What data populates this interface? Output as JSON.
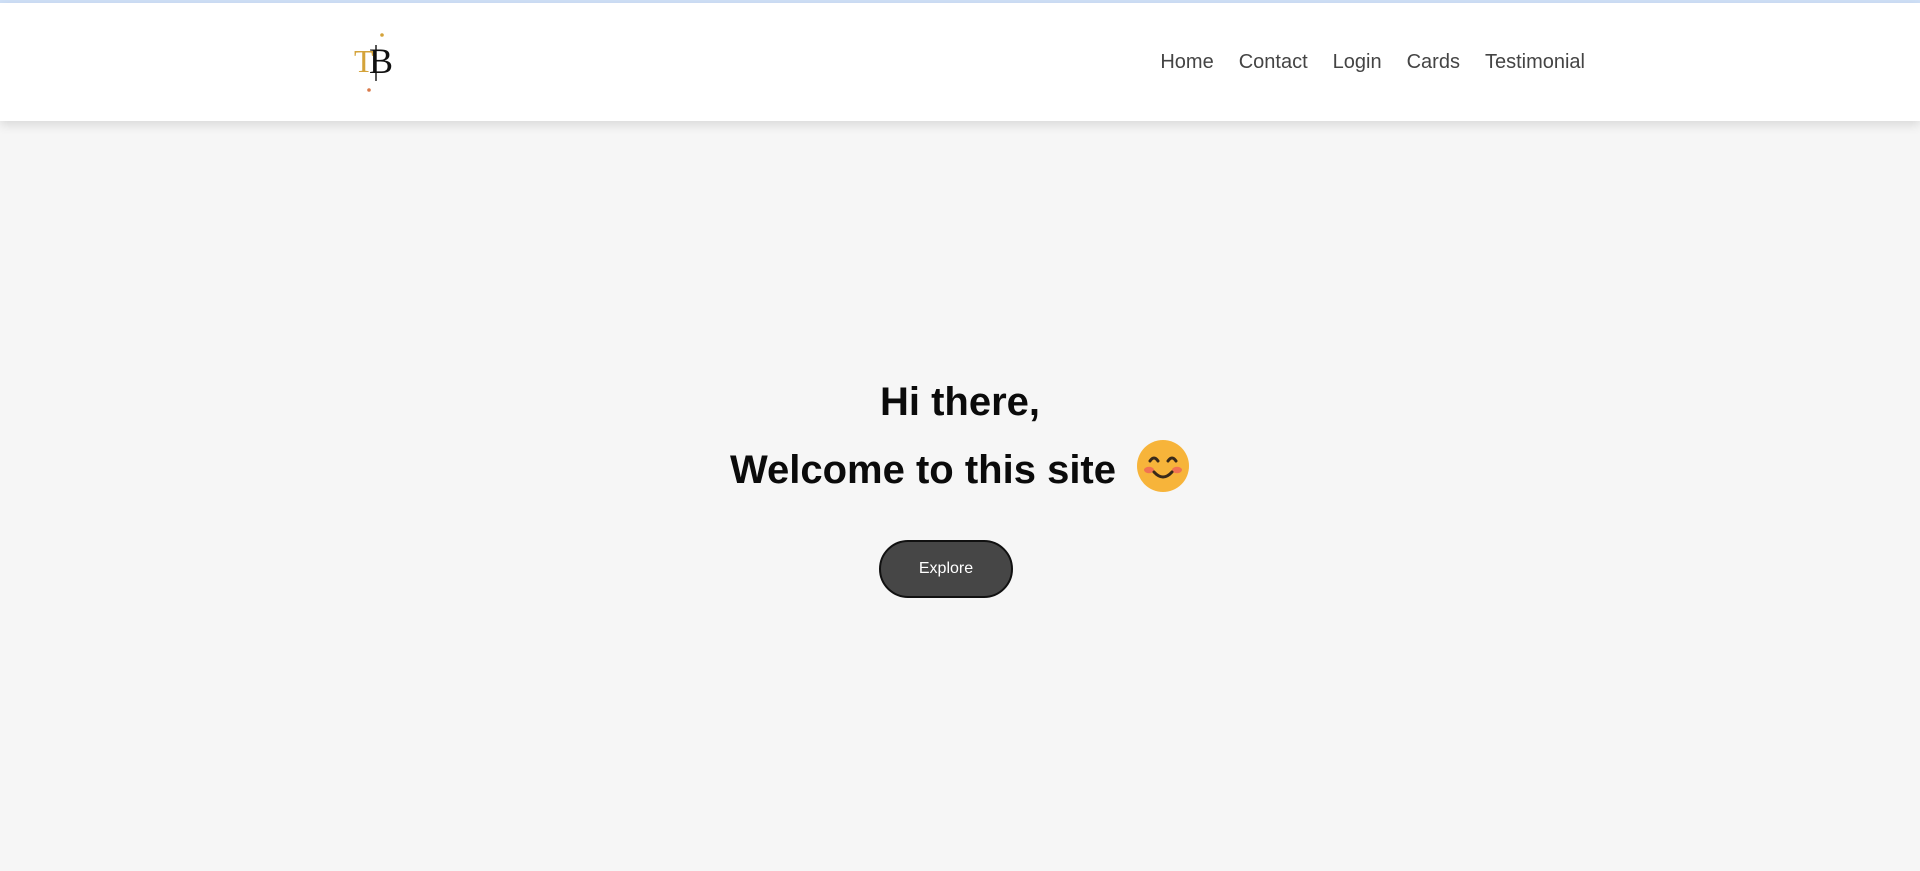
{
  "header": {
    "logo_alt": "TB",
    "nav_links": [
      {
        "label": "Home"
      },
      {
        "label": "Contact"
      },
      {
        "label": "Login"
      },
      {
        "label": "Cards"
      },
      {
        "label": "Testimonial"
      }
    ]
  },
  "hero": {
    "line1": "Hi there,",
    "line2": "Welcome to this site",
    "emoji_icon": "smiling-face-icon",
    "explore_label": "Explore"
  },
  "colors": {
    "top_accent": "#cfe0f7",
    "page_background": "#f6f6f6",
    "header_background": "#ffffff",
    "nav_text": "#444444",
    "button_background": "#464646",
    "button_text": "#ffffff",
    "logo_gold": "#d4a33a",
    "logo_dark": "#111111"
  }
}
